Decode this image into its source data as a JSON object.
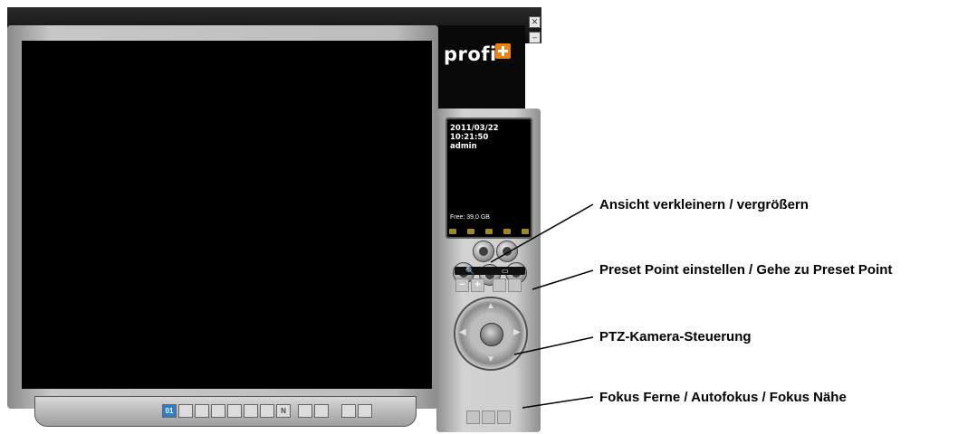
{
  "brand": {
    "logo_text": "profi",
    "logo_accent": "#f0800f"
  },
  "window_controls": {
    "close_symbol": "✕",
    "minimize_symbol": "–"
  },
  "info_panel": {
    "date": "2011/03/22",
    "time": "10:21:50",
    "user": "admin",
    "free_space": "Free: 39,0 GB"
  },
  "controls": {
    "zoom_minus": "−",
    "zoom_plus": "+",
    "layout_active": "01",
    "layout_n": "N"
  },
  "annotations": [
    {
      "text": "Ansicht verkleinern / vergrößern"
    },
    {
      "text": "Preset Point einstellen /  Gehe zu Preset Point"
    },
    {
      "text": "PTZ-Kamera-Steuerung"
    },
    {
      "text": "Fokus Ferne  / Autofokus / Fokus Nähe"
    }
  ]
}
